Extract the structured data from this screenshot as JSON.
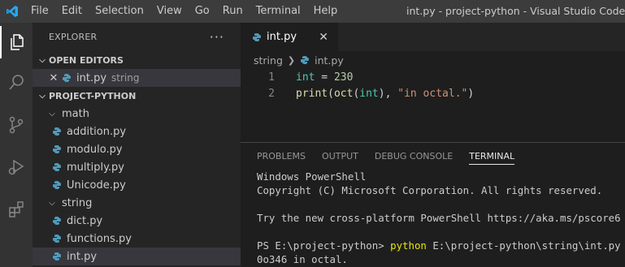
{
  "menu": [
    "File",
    "Edit",
    "Selection",
    "View",
    "Go",
    "Run",
    "Terminal",
    "Help"
  ],
  "window_title": "int.py - project-python - Visual Studio Code [Un",
  "explorer": {
    "title": "EXPLORER",
    "more": "···",
    "open_editors_label": "OPEN EDITORS",
    "open_editor": {
      "name": "int.py",
      "desc": "string"
    },
    "project_label": "PROJECT-PYTHON",
    "folders": [
      {
        "name": "math",
        "files": [
          "addition.py",
          "modulo.py",
          "multiply.py",
          "Unicode.py"
        ]
      },
      {
        "name": "string",
        "files": [
          "dict.py",
          "functions.py",
          "int.py"
        ]
      }
    ]
  },
  "editor": {
    "tab_label": "int.py",
    "breadcrumb": {
      "folder": "string",
      "file": "int.py"
    },
    "lines": [
      {
        "n": "1",
        "tokens": [
          [
            "var",
            "int"
          ],
          [
            "plain",
            " = "
          ],
          [
            "num",
            "230"
          ]
        ]
      },
      {
        "n": "2",
        "tokens": [
          [
            "fn",
            "print"
          ],
          [
            "plain",
            "("
          ],
          [
            "fn",
            "oct"
          ],
          [
            "plain",
            "("
          ],
          [
            "var",
            "int"
          ],
          [
            "plain",
            "), "
          ],
          [
            "str",
            "\"in octal.\""
          ],
          [
            "plain",
            ")"
          ]
        ]
      }
    ]
  },
  "panel": {
    "tabs": [
      "PROBLEMS",
      "OUTPUT",
      "DEBUG CONSOLE",
      "TERMINAL"
    ],
    "active_tab": "TERMINAL",
    "terminal": {
      "line1": "Windows PowerShell",
      "line2": "Copyright (C) Microsoft Corporation. All rights reserved.",
      "line3": "Try the new cross-platform PowerShell https://aka.ms/pscore6",
      "prompt": "PS E:\\project-python> ",
      "cmd": "python",
      "args": " E:\\project-python\\string\\int.py",
      "output": "0o346 in octal."
    }
  },
  "colors": {
    "accent": "#007acc",
    "python_icon": "#519aba"
  }
}
